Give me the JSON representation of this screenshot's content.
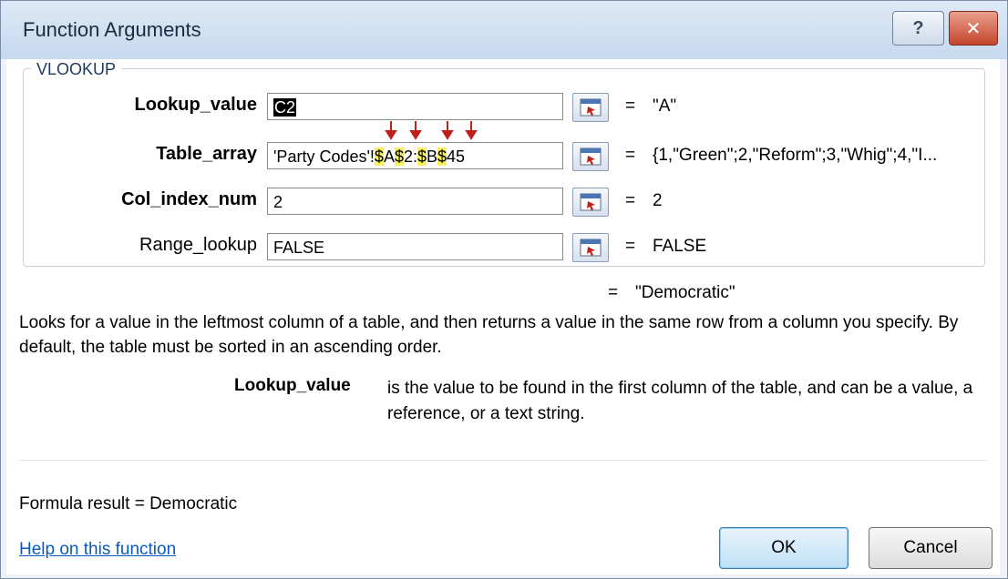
{
  "window": {
    "title": "Function Arguments",
    "help_glyph": "?",
    "close_glyph": "✕"
  },
  "function_name": "VLOOKUP",
  "arguments": [
    {
      "label": "Lookup_value",
      "value": "C2",
      "result": "\"A\""
    },
    {
      "label": "Table_array",
      "value": "'Party Codes'!$A$2:$B$45",
      "result": "{1,\"Green\";2,\"Reform\";3,\"Whig\";4,\"I..."
    },
    {
      "label": "Col_index_num",
      "value": "2",
      "result": "2"
    },
    {
      "label": "Range_lookup",
      "value": "FALSE",
      "result": "FALSE"
    }
  ],
  "table_array_parts": {
    "prefix": "'Party Codes'!",
    "d1": "$",
    "a": "A",
    "d2": "$",
    "n2": "2:",
    "d3": "$",
    "b": "B",
    "d4": "$",
    "n45": "45"
  },
  "equals_sign": "=",
  "function_result": "\"Democratic\"",
  "description": "Looks for a value in the leftmost column of a table, and then returns a value in the same row from a column you specify. By default, the table must be sorted in an ascending order.",
  "arg_description": {
    "name": "Lookup_value",
    "text": "is the value to be found in the first column of the table, and can be a value, a reference, or a text string."
  },
  "formula_result": "Formula result =  Democratic",
  "help_link": "Help on this function",
  "buttons": {
    "ok": "OK",
    "cancel": "Cancel"
  },
  "colors": {
    "highlight": "#f6f060",
    "arrow": "#c0201a",
    "link": "#0a58c2"
  }
}
